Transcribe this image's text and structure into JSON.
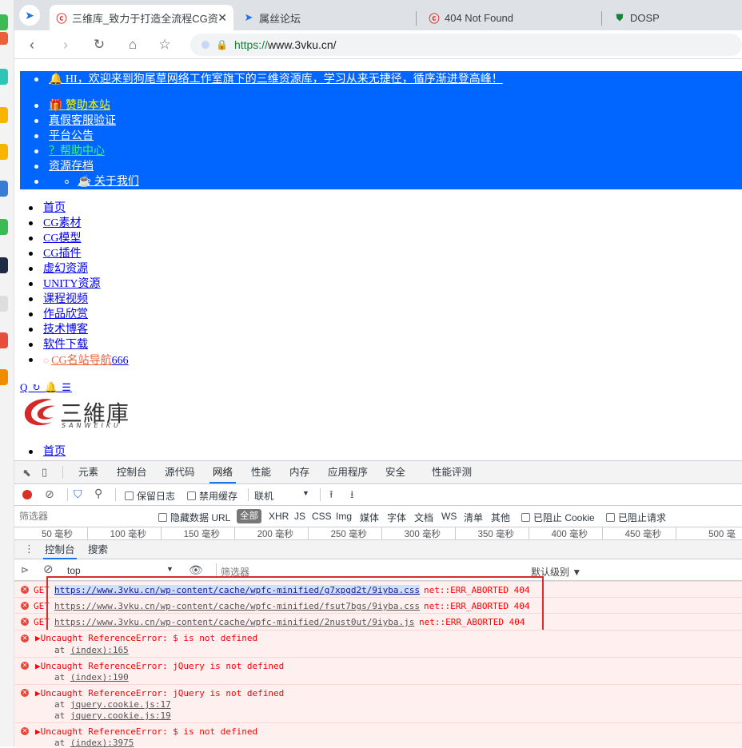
{
  "tabs": [
    {
      "title": "三维库_致力于打造全流程CG资",
      "active": true,
      "favicon": "sanweiku-logo-icon",
      "color": "#d93025"
    },
    {
      "title": "属丝论坛",
      "active": false,
      "favicon": "paper-plane-icon",
      "color": "#1a73e8"
    },
    {
      "title": "404 Not Found",
      "active": false,
      "favicon": "sanweiku-logo-icon",
      "color": "#d93025"
    },
    {
      "title": "DOSP",
      "active": false,
      "favicon": "shield-icon",
      "color": "#188038"
    }
  ],
  "address": {
    "scheme": "https://",
    "host": "www.3vku.cn/"
  },
  "page": {
    "announcement": "🔔 HI，欢迎来到狗尾草网络工作室旗下的三维资源库，学习从来无捷径，循序渐进登高峰！",
    "top_menu": [
      "🎁 赞助本站",
      "真假客服验证",
      "平台公告",
      "？帮助中心",
      "资源存档",
      "☕ 关于我们"
    ],
    "main_menu": [
      "首页",
      "CG素材",
      "CG模型",
      "CG插件",
      "虚幻资源",
      "UNITY资源",
      "课程视频",
      "作品欣赏",
      "技术博客",
      "软件下载"
    ],
    "special_link": {
      "prefix": "CG名站导航",
      "suffix": "666"
    },
    "icon_row": "Q ↻ 🔔 ☰",
    "logo": {
      "brand": "三維庫",
      "sub": "SANWEIKU"
    },
    "bottom_item": "首页"
  },
  "devtools": {
    "tabs": [
      "元素",
      "控制台",
      "源代码",
      "网络",
      "性能",
      "内存",
      "应用程序",
      "安全",
      "性能评测"
    ],
    "active_tab": "网络",
    "toolbar": {
      "preserve_log": "保留日志",
      "disable_cache": "禁用缓存",
      "throttle": "联机"
    },
    "filter": {
      "placeholder": "筛选器",
      "hide_data_url": "隐藏数据 URL",
      "all": "全部",
      "types": [
        "XHR",
        "JS",
        "CSS",
        "Img",
        "媒体",
        "字体",
        "文档",
        "WS",
        "清单",
        "其他"
      ],
      "blocked_cookie": "已阻止 Cookie",
      "blocked_requests": "已阻止请求"
    },
    "timeline_ticks": [
      "50 毫秒",
      "100 毫秒",
      "150 毫秒",
      "200 毫秒",
      "250 毫秒",
      "300 毫秒",
      "350 毫秒",
      "400 毫秒",
      "450 毫秒",
      "500 毫"
    ],
    "drawer_tabs": [
      "控制台",
      "搜索"
    ],
    "console_toolbar": {
      "context": "top",
      "filter_placeholder": "筛选器",
      "levels": "默认级别 ▼"
    },
    "console_lines": [
      {
        "prefix": "GET",
        "url": "https://www.3vku.cn/wp-content/cache/wpfc-minified/g7xpgd2t/9iyba.css",
        "tail": "net::ERR_ABORTED 404",
        "highlight": true
      },
      {
        "prefix": "GET",
        "url": "https://www.3vku.cn/wp-content/cache/wpfc-minified/fsut7bgs/9iyba.css",
        "tail": "net::ERR_ABORTED 404",
        "highlight": false
      },
      {
        "prefix": "GET",
        "url": "https://www.3vku.cn/wp-content/cache/wpfc-minified/2nust0ut/9iyba.js",
        "tail": "net::ERR_ABORTED 404",
        "highlight": false
      }
    ],
    "errors": [
      {
        "message": "▶Uncaught ReferenceError: $ is not defined",
        "stack": [
          "(index):165"
        ]
      },
      {
        "message": "▶Uncaught ReferenceError: jQuery is not defined",
        "stack": [
          "(index):190"
        ]
      },
      {
        "message": "▶Uncaught ReferenceError: jQuery is not defined",
        "stack": [
          "jquery.cookie.js:17",
          "jquery.cookie.js:19"
        ]
      },
      {
        "message": "▶Uncaught ReferenceError: $ is not defined",
        "stack": [
          "(index):3975"
        ]
      }
    ],
    "stack_prefix": "at"
  },
  "colors": {
    "topbar": "#0066ff",
    "highlight_box": "#d32f2f",
    "error_bg": "#fff0f0"
  }
}
